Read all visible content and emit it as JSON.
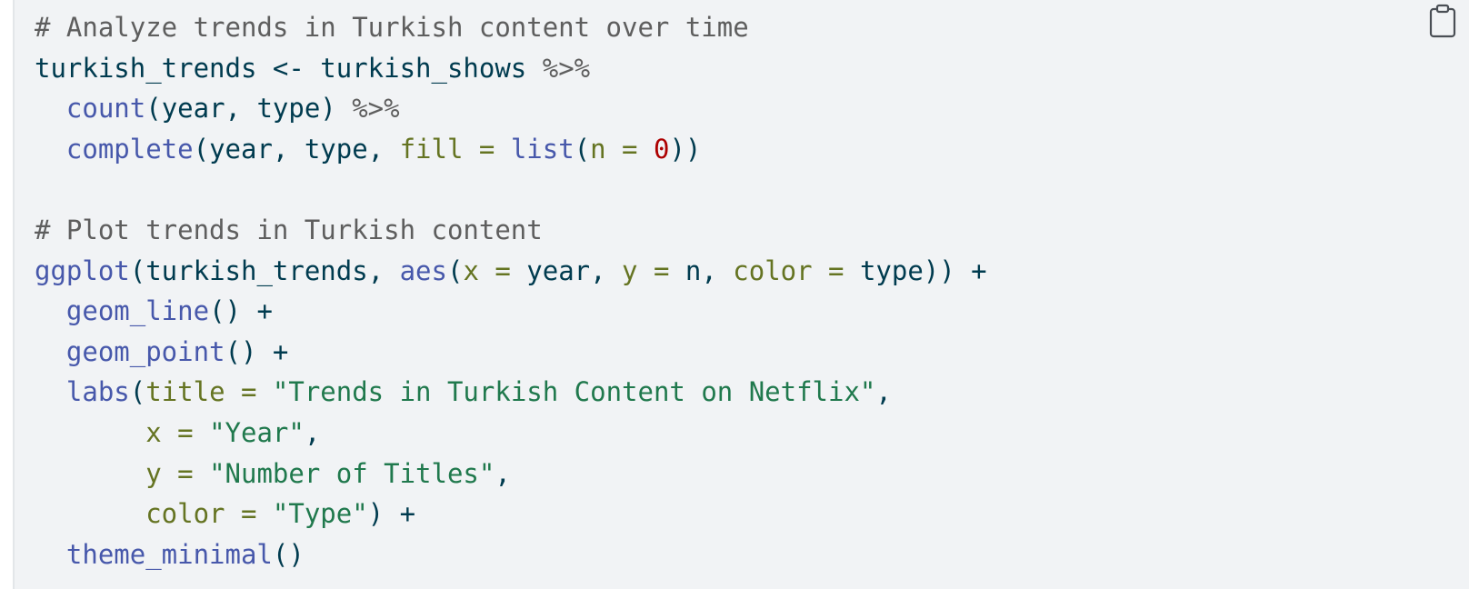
{
  "code_block": {
    "language": "r",
    "copy_icon": "clipboard-icon",
    "colors": {
      "background": "#f1f3f5",
      "comment": "#5e5e5e",
      "function": "#4758ab",
      "argument": "#657422",
      "string": "#20794d",
      "number": "#ad0000",
      "identifier": "#003b4f"
    },
    "lines": [
      [
        {
          "t": "comment",
          "v": "# Analyze trends in Turkish content over time"
        }
      ],
      [
        {
          "t": "id",
          "v": "turkish_trends "
        },
        {
          "t": "id",
          "v": "<-"
        },
        {
          "t": "id",
          "v": " turkish_shows "
        },
        {
          "t": "op",
          "v": "%>%"
        }
      ],
      [
        {
          "t": "plain",
          "v": "  "
        },
        {
          "t": "fn",
          "v": "count"
        },
        {
          "t": "id",
          "v": "(year, type) "
        },
        {
          "t": "op",
          "v": "%>%"
        }
      ],
      [
        {
          "t": "plain",
          "v": "  "
        },
        {
          "t": "fn",
          "v": "complete"
        },
        {
          "t": "id",
          "v": "(year, type, "
        },
        {
          "t": "arg",
          "v": "fill ="
        },
        {
          "t": "plain",
          "v": " "
        },
        {
          "t": "fn",
          "v": "list"
        },
        {
          "t": "id",
          "v": "("
        },
        {
          "t": "arg",
          "v": "n ="
        },
        {
          "t": "plain",
          "v": " "
        },
        {
          "t": "num",
          "v": "0"
        },
        {
          "t": "id",
          "v": "))"
        }
      ],
      [
        {
          "t": "plain",
          "v": " "
        }
      ],
      [
        {
          "t": "comment",
          "v": "# Plot trends in Turkish content"
        }
      ],
      [
        {
          "t": "fn",
          "v": "ggplot"
        },
        {
          "t": "id",
          "v": "(turkish_trends, "
        },
        {
          "t": "fn",
          "v": "aes"
        },
        {
          "t": "id",
          "v": "("
        },
        {
          "t": "arg",
          "v": "x ="
        },
        {
          "t": "id",
          "v": " year, "
        },
        {
          "t": "arg",
          "v": "y ="
        },
        {
          "t": "id",
          "v": " n, "
        },
        {
          "t": "arg",
          "v": "color ="
        },
        {
          "t": "id",
          "v": " type)) +"
        }
      ],
      [
        {
          "t": "plain",
          "v": "  "
        },
        {
          "t": "fn",
          "v": "geom_line"
        },
        {
          "t": "id",
          "v": "() +"
        }
      ],
      [
        {
          "t": "plain",
          "v": "  "
        },
        {
          "t": "fn",
          "v": "geom_point"
        },
        {
          "t": "id",
          "v": "() +"
        }
      ],
      [
        {
          "t": "plain",
          "v": "  "
        },
        {
          "t": "fn",
          "v": "labs"
        },
        {
          "t": "id",
          "v": "("
        },
        {
          "t": "arg",
          "v": "title ="
        },
        {
          "t": "plain",
          "v": " "
        },
        {
          "t": "str",
          "v": "\"Trends in Turkish Content on Netflix\""
        },
        {
          "t": "id",
          "v": ","
        }
      ],
      [
        {
          "t": "plain",
          "v": "       "
        },
        {
          "t": "arg",
          "v": "x ="
        },
        {
          "t": "plain",
          "v": " "
        },
        {
          "t": "str",
          "v": "\"Year\""
        },
        {
          "t": "id",
          "v": ","
        }
      ],
      [
        {
          "t": "plain",
          "v": "       "
        },
        {
          "t": "arg",
          "v": "y ="
        },
        {
          "t": "plain",
          "v": " "
        },
        {
          "t": "str",
          "v": "\"Number of Titles\""
        },
        {
          "t": "id",
          "v": ","
        }
      ],
      [
        {
          "t": "plain",
          "v": "       "
        },
        {
          "t": "arg",
          "v": "color ="
        },
        {
          "t": "plain",
          "v": " "
        },
        {
          "t": "str",
          "v": "\"Type\""
        },
        {
          "t": "id",
          "v": ") +"
        }
      ],
      [
        {
          "t": "plain",
          "v": "  "
        },
        {
          "t": "fn",
          "v": "theme_minimal"
        },
        {
          "t": "id",
          "v": "()"
        }
      ]
    ]
  }
}
